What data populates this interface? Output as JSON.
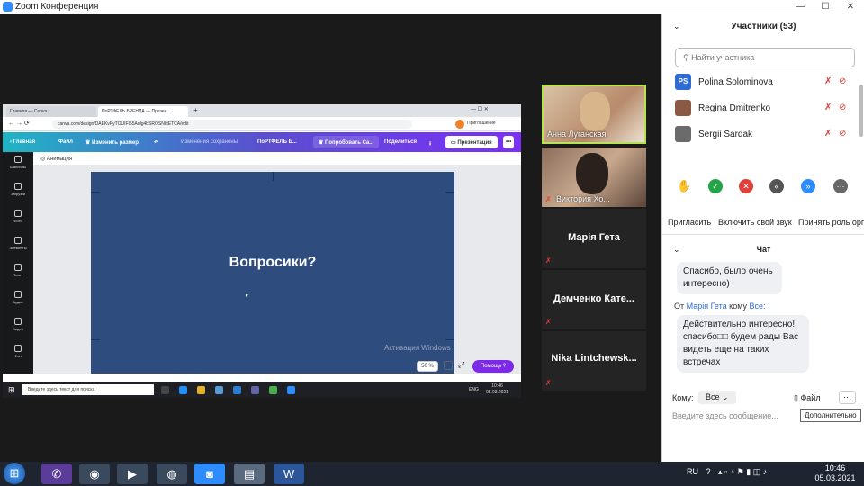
{
  "window": {
    "title": "Zoom Конференция"
  },
  "share": {
    "tabs": [
      "Главная — Canva",
      "ПоРТФЕЛЬ БРЕНДА — Презен..."
    ],
    "url": "canva.com/design/DAEKvPyTOUIFI55Aulg4bSROSNktETCA/edit",
    "canva_toolbar": {
      "home": "Главная",
      "file": "Файл",
      "resize": "Изменить размер",
      "saved": "Изменения сохранены",
      "doc_title": "ПоРТФЕЛЬ Б...",
      "try": "Попробовать Ca...",
      "share": "Поделиться",
      "present": "Презентация",
      "more": "•••",
      "invite": "Приглашение"
    },
    "side_items": [
      "Шаблоны",
      "Загрузки",
      "Фото",
      "Элементы",
      "Текст",
      "Аудио",
      "Видео",
      "Фон"
    ],
    "animation_label": "Анимация",
    "slide_text": "Вопросики?",
    "activation": "Активация Windows",
    "zoom_pct": "50 %",
    "help": "Помощь ?",
    "taskbar_search": "Введите здесь текст для поиска",
    "taskbar_lang": "ENG",
    "taskbar_time": "10:46",
    "taskbar_date": "05.03.2021"
  },
  "thumbnails": [
    {
      "name": "Анна Луганская",
      "video": true,
      "active": true
    },
    {
      "name": "Виктория Хо...",
      "video": true,
      "active": false
    },
    {
      "name": "Марія Гета",
      "video": false
    },
    {
      "name": "Демченко Кате...",
      "video": false
    },
    {
      "name": "Nika Lintchewsk...",
      "video": false
    }
  ],
  "panel": {
    "title": "Участники (53)",
    "search_placeholder": "Найти участника",
    "participants": [
      {
        "initials": "PS",
        "name": "Polina Solominova",
        "color": "#2d6bd6"
      },
      {
        "initials": "",
        "name": "Regina Dmitrenko",
        "color": "#8a5a44"
      },
      {
        "initials": "",
        "name": "Sergii Sardak",
        "color": "#6b6b6b"
      }
    ],
    "actions": [
      "Пригласить",
      "Включить свой звук",
      "Принять роль орга"
    ],
    "chat_title": "Чат",
    "messages": [
      {
        "text_lines": [
          "Спасибо, было очень",
          "интересно)"
        ]
      },
      {
        "from_prefix": "От",
        "from": "Марія Гета",
        "to_prefix": "кому",
        "to": "Все:",
        "text_lines": [
          "Действительно интересно!",
          "спасибо□□ будем рады Вас",
          "видеть еще на таких",
          "встречах"
        ]
      }
    ],
    "send_to_label": "Кому:",
    "send_to_value": "Все",
    "file_label": "Файл",
    "input_placeholder": "Введите здесь сообщение...",
    "more_tooltip": "Дополнительно"
  },
  "taskbar": {
    "lang": "RU",
    "time": "10:46",
    "date": "05.03.2021"
  },
  "colors": {
    "accent": "#2d8cff",
    "canva_purple": "#7d2ae8",
    "slide_bg": "#2e4c7e",
    "active_border": "#b6e34f"
  }
}
